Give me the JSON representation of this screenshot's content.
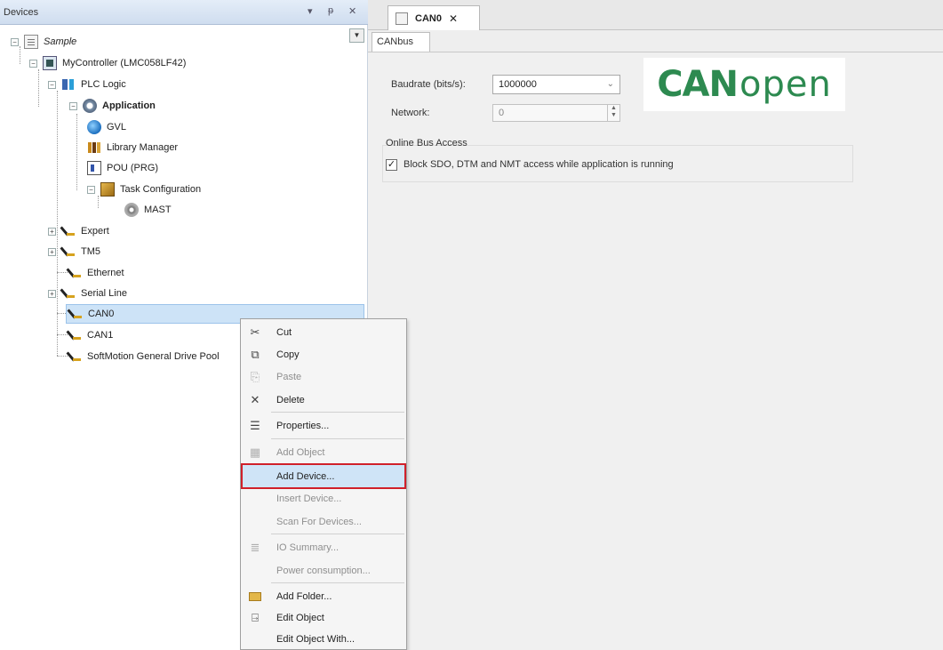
{
  "devices_panel": {
    "title": "Devices",
    "header_icons": [
      "dropdown-arrow-icon",
      "pin-icon",
      "close-icon"
    ],
    "tree": {
      "root": "Sample",
      "controller": "MyController (LMC058LF42)",
      "plc_logic": "PLC Logic",
      "application": "Application",
      "gvl": "GVL",
      "library_manager": "Library Manager",
      "pou": "POU (PRG)",
      "task_configuration": "Task Configuration",
      "mast": "MAST",
      "expert": "Expert",
      "tm5": "TM5",
      "ethernet": "Ethernet",
      "serial_line": "Serial Line",
      "can0": "CAN0",
      "can1": "CAN1",
      "softmotion": "SoftMotion General Drive Pool"
    }
  },
  "editor": {
    "tab_label": "CAN0",
    "subtab_label": "CANbus",
    "baudrate_label": "Baudrate (bits/s):",
    "baudrate_value": "1000000",
    "network_label": "Network:",
    "network_value": "0",
    "logo_can": "CAN",
    "logo_open": "open",
    "group_title": "Online Bus Access",
    "checkbox_checked": true,
    "checkbox_mark": "✓",
    "checkbox_label": "Block SDO, DTM and NMT access while application is running"
  },
  "context_menu": {
    "cut": "Cut",
    "copy": "Copy",
    "paste": "Paste",
    "delete": "Delete",
    "properties": "Properties...",
    "add_object": "Add Object",
    "add_device": "Add Device...",
    "insert_device": "Insert Device...",
    "scan_for_devices": "Scan For Devices...",
    "io_summary": "IO Summary...",
    "power_consumption": "Power consumption...",
    "add_folder": "Add Folder...",
    "edit_object": "Edit Object",
    "edit_object_with": "Edit Object With..."
  },
  "colors": {
    "selection": "#cde3f7",
    "highlight_border": "#d0202a",
    "canopen_green": "#2d8a50"
  }
}
